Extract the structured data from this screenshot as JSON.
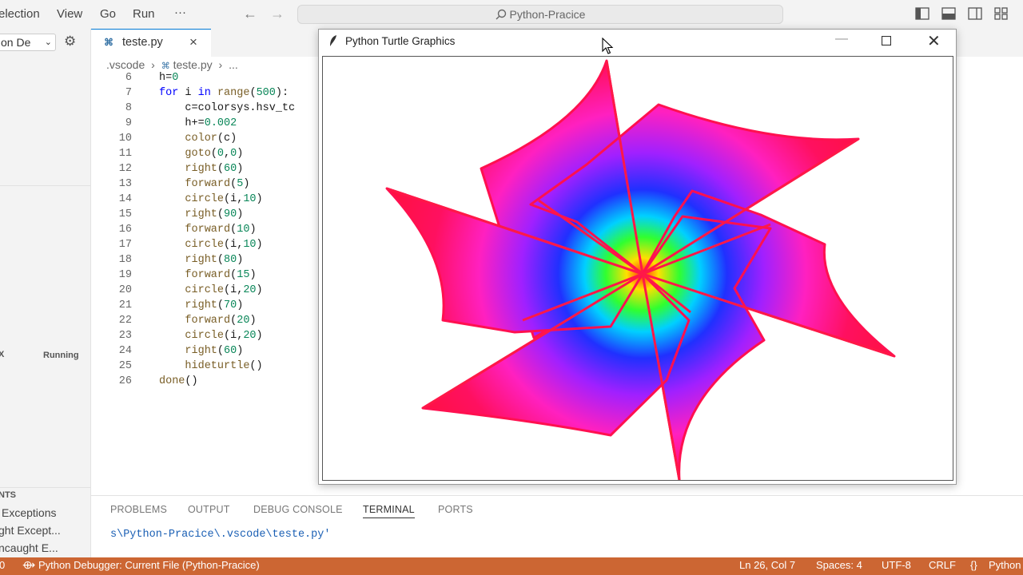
{
  "menu": [
    "election",
    "View",
    "Go",
    "Run",
    "···"
  ],
  "command_center": "Python-Pracice",
  "sidebar": {
    "select_value": "on De",
    "running_prefix": "X",
    "running_label": "Running",
    "breakpoints_header": "NTS",
    "breakpoints": [
      "Exceptions",
      "ght Except...",
      "ncaught E..."
    ]
  },
  "editor": {
    "tab_label": "teste.py",
    "breadcrumb": [
      ".vscode",
      "teste.py",
      "..."
    ],
    "lines": [
      {
        "n": "6",
        "t": "h=0"
      },
      {
        "n": "7",
        "t": "for i in range(500):"
      },
      {
        "n": "8",
        "t": "    c=colorsys.hsv_tc"
      },
      {
        "n": "9",
        "t": "    h+=0.002"
      },
      {
        "n": "10",
        "t": "    color(c)"
      },
      {
        "n": "11",
        "t": "    goto(0,0)"
      },
      {
        "n": "12",
        "t": "    right(60)"
      },
      {
        "n": "13",
        "t": "    forward(5)"
      },
      {
        "n": "14",
        "t": "    circle(i,10)"
      },
      {
        "n": "15",
        "t": "    right(90)"
      },
      {
        "n": "16",
        "t": "    forward(10)"
      },
      {
        "n": "17",
        "t": "    circle(i,10)"
      },
      {
        "n": "18",
        "t": "    right(80)"
      },
      {
        "n": "19",
        "t": "    forward(15)"
      },
      {
        "n": "20",
        "t": "    circle(i,20)"
      },
      {
        "n": "21",
        "t": "    right(70)"
      },
      {
        "n": "22",
        "t": "    forward(20)"
      },
      {
        "n": "23",
        "t": "    circle(i,20)"
      },
      {
        "n": "24",
        "t": "    right(60)"
      },
      {
        "n": "25",
        "t": "    hideturtle()"
      },
      {
        "n": "26",
        "t": "done()"
      }
    ]
  },
  "panel": {
    "tabs": [
      "PROBLEMS",
      "OUTPUT",
      "DEBUG CONSOLE",
      "TERMINAL",
      "PORTS"
    ],
    "active_tab": "TERMINAL",
    "terminal_text": "s\\Python-Pracice\\.vscode\\teste.py'"
  },
  "turtle_window": {
    "title": "Python Turtle Graphics"
  },
  "status": {
    "left_num": "0",
    "debugger": "Python Debugger: Current File (Python-Pracice)",
    "position": "Ln 26, Col 7",
    "spaces": "Spaces: 4",
    "encoding": "UTF-8",
    "eol": "CRLF",
    "language": "Python"
  },
  "colors": {
    "status_bar": "#cc6633",
    "accent": "#0078d4"
  }
}
